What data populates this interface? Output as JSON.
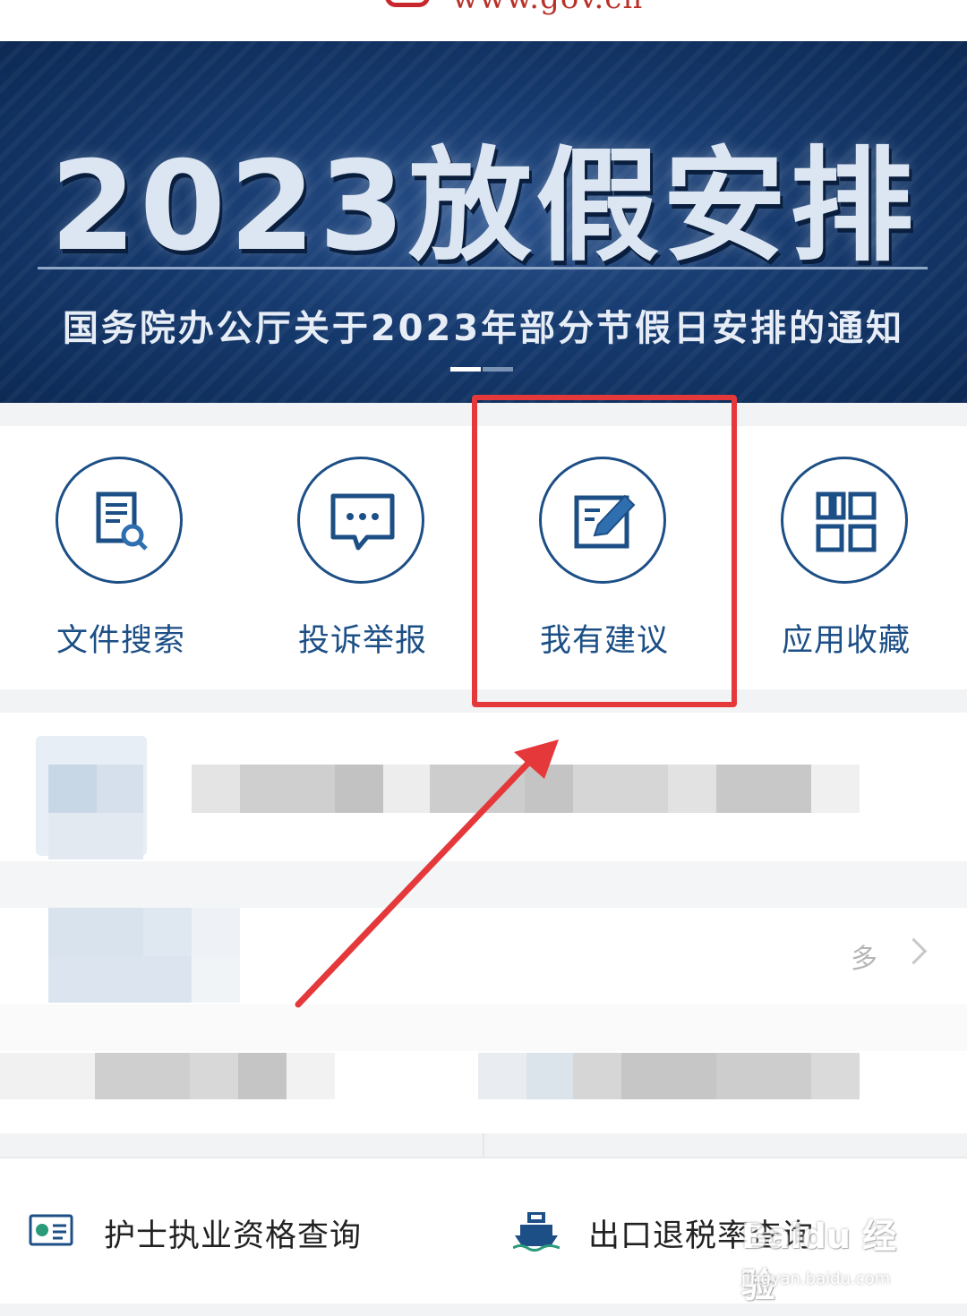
{
  "header": {
    "url_fragment": "www.gov.cn"
  },
  "banner": {
    "title": "2023放假安排",
    "subtitle": "国务院办公厅关于2023年部分节假日安排的通知",
    "slide_count": 2,
    "active_slide": 1
  },
  "quick_actions": [
    {
      "label": "文件搜索",
      "icon": "document-search-icon"
    },
    {
      "label": "投诉举报",
      "icon": "chat-bubble-icon"
    },
    {
      "label": "我有建议",
      "icon": "edit-pencil-icon"
    },
    {
      "label": "应用收藏",
      "icon": "app-grid-icon"
    }
  ],
  "annotation": {
    "highlight_color": "#e5383b",
    "target": "我有建议"
  },
  "section": {
    "more_label": "多"
  },
  "bottom_tiles": [
    {
      "label": "护士执业资格查询",
      "icon": "id-card-icon"
    },
    {
      "label": "出口退税率查询",
      "icon": "ship-icon"
    }
  ],
  "watermark": {
    "main": "Baidu 经验",
    "sub": "jingyan.baidu.com"
  },
  "colors": {
    "accent": "#1c4f86",
    "banner_bg": "#163a6e",
    "annotation_red": "#e5383b"
  }
}
